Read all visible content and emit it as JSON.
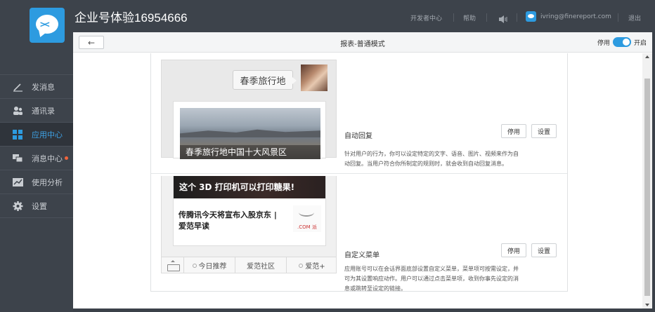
{
  "app": {
    "title": "企业号体验16954666"
  },
  "header": {
    "links": [
      "开发者中心",
      "帮助"
    ],
    "user_email": "ivring@finereport.com",
    "logout": "退出"
  },
  "sidebar": {
    "items": [
      {
        "label": "发消息",
        "icon": "pencil-icon",
        "active": false
      },
      {
        "label": "通讯录",
        "icon": "contacts-icon",
        "active": false
      },
      {
        "label": "应用中心",
        "icon": "apps-icon",
        "active": true
      },
      {
        "label": "消息中心",
        "icon": "message-icon",
        "active": false,
        "badge": true
      },
      {
        "label": "使用分析",
        "icon": "analytics-icon",
        "active": false
      },
      {
        "label": "设置",
        "icon": "gear-icon",
        "active": false
      }
    ]
  },
  "toolbar": {
    "back_label": "←",
    "title": "报表-普通模式",
    "disable_label": "停用",
    "enable_label": "开启",
    "toggle_on": true
  },
  "features": [
    {
      "title": "自动回复",
      "description": "针对用户的行为，你可以设定特定的文字、语音、图片、视频来作为自动回复。当用户符合你所制定的规则时，就会收到自动回复消息。",
      "disable_button": "停用",
      "settings_button": "设置",
      "preview": {
        "bubble_text": "春季旅行地",
        "news_caption": "春季旅行地中国十大风景区"
      }
    },
    {
      "title": "自定义菜单",
      "description": "应用账号可以在会话界面底部设置自定义菜单，菜单项可按需设定，并可为其设置响应动作。用户可以通过点击菜单项，收到你事先设定的消息或跳转至设定的链接。",
      "disable_button": "停用",
      "settings_button": "设置",
      "preview": {
        "banner_text": "这个 3D 打印机可以打印糖果!",
        "article_text": "传腾讯今天将宣布入股京东 | 爱范早读",
        "logo_text": ".COM 派",
        "menu_items": [
          "今日推荐",
          "爱范社区",
          "爱范+"
        ]
      }
    }
  ],
  "colors": {
    "accent": "#2d9be0",
    "sidebar_bg": "#3d434b",
    "badge": "#f0643c"
  }
}
